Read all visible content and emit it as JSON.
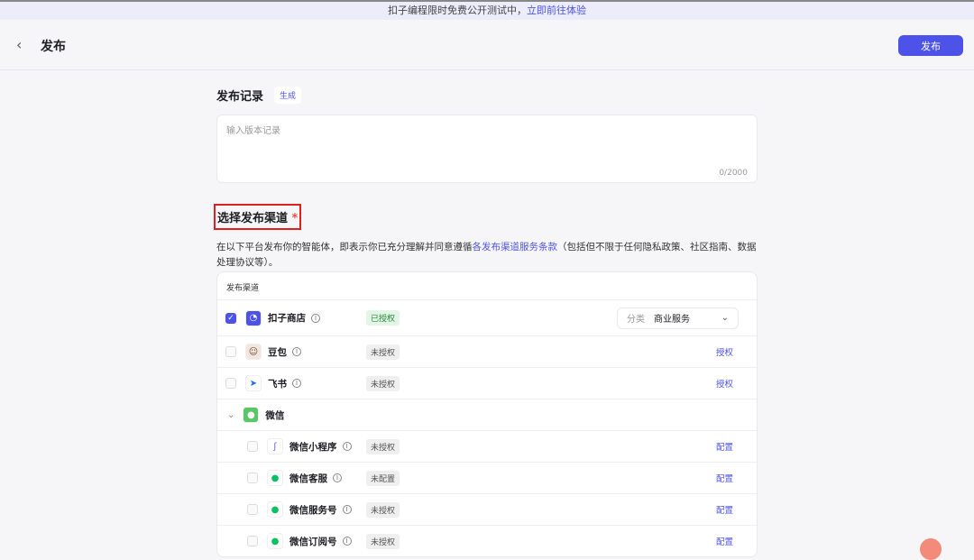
{
  "banner": {
    "text": "扣子编程限时免费公开测试中，",
    "link": "立即前往体验"
  },
  "header": {
    "title": "发布",
    "publish_button": "发布"
  },
  "record": {
    "title": "发布记录",
    "generate": "生成",
    "placeholder": "输入版本记录",
    "counter": "0/2000"
  },
  "channels": {
    "title": "选择发布渠道",
    "required": "*",
    "desc_before": "在以下平台发布你的智能体，即表示你已充分理解并同意遵循",
    "desc_link": "各发布渠道服务条款",
    "desc_after": "（包括但不限于任何隐私政策、社区指南、数据处理协议等）。",
    "table_header": "发布渠道"
  },
  "rows": [
    {
      "name": "扣子商店",
      "status": "已授权",
      "checked": true,
      "category_label": "分类",
      "category_value": "商业服务"
    },
    {
      "name": "豆包",
      "status": "未授权",
      "action": "授权"
    },
    {
      "name": "飞书",
      "status": "未授权",
      "action": "授权"
    },
    {
      "name": "微信"
    },
    {
      "name": "微信小程序",
      "status": "未授权",
      "action": "配置"
    },
    {
      "name": "微信客服",
      "status": "未配置",
      "action": "配置"
    },
    {
      "name": "微信服务号",
      "status": "未授权",
      "action": "配置"
    },
    {
      "name": "微信订阅号",
      "status": "未授权",
      "action": "配置"
    }
  ],
  "colors": {
    "accent": "#4d53e8",
    "wechat": "#07c160"
  }
}
